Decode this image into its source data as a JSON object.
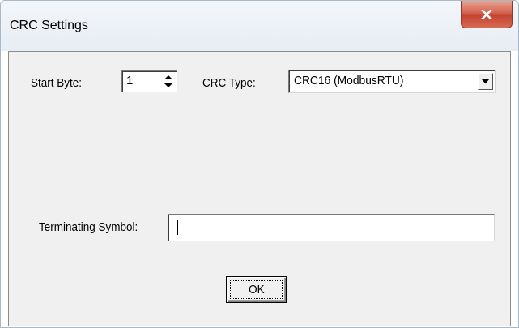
{
  "window": {
    "title": "CRC Settings",
    "close_icon": "close-icon"
  },
  "form": {
    "start_byte": {
      "label": "Start Byte:",
      "value": "1"
    },
    "crc_type": {
      "label": "CRC Type:",
      "selected": "CRC16 (ModbusRTU)"
    },
    "terminating_symbol": {
      "label": "Terminating Symbol:",
      "value": ""
    },
    "ok_label": "OK"
  },
  "colors": {
    "close_button": "#c8503c",
    "dialog_background": "#f0f0f0"
  }
}
